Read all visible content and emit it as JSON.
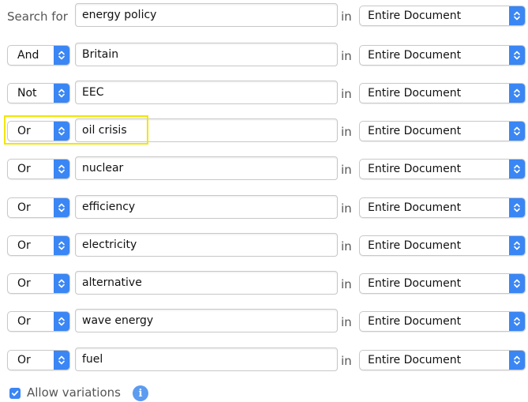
{
  "search_for_label": "Search for",
  "in_label": "in",
  "rows": [
    {
      "operator": "",
      "term": "energy policy",
      "scope": "Entire Document"
    },
    {
      "operator": "And",
      "term": "Britain",
      "scope": "Entire Document"
    },
    {
      "operator": "Not",
      "term": "EEC",
      "scope": "Entire Document"
    },
    {
      "operator": "Or",
      "term": "oil crisis",
      "scope": "Entire Document"
    },
    {
      "operator": "Or",
      "term": "nuclear",
      "scope": "Entire Document"
    },
    {
      "operator": "Or",
      "term": "efficiency",
      "scope": "Entire Document"
    },
    {
      "operator": "Or",
      "term": "electricity",
      "scope": "Entire Document"
    },
    {
      "operator": "Or",
      "term": "alternative",
      "scope": "Entire Document"
    },
    {
      "operator": "Or",
      "term": "wave energy",
      "scope": "Entire Document"
    },
    {
      "operator": "Or",
      "term": "fuel",
      "scope": "Entire Document"
    }
  ],
  "footer": {
    "allow_variations_label": "Allow variations",
    "allow_variations_checked": true
  },
  "colors": {
    "accent": "#3a86f4",
    "highlight": "#f2e500"
  },
  "icons": {
    "stepper": "up-down-chevron-icon",
    "checkbox": "checkmark-icon",
    "info": "info-icon"
  }
}
